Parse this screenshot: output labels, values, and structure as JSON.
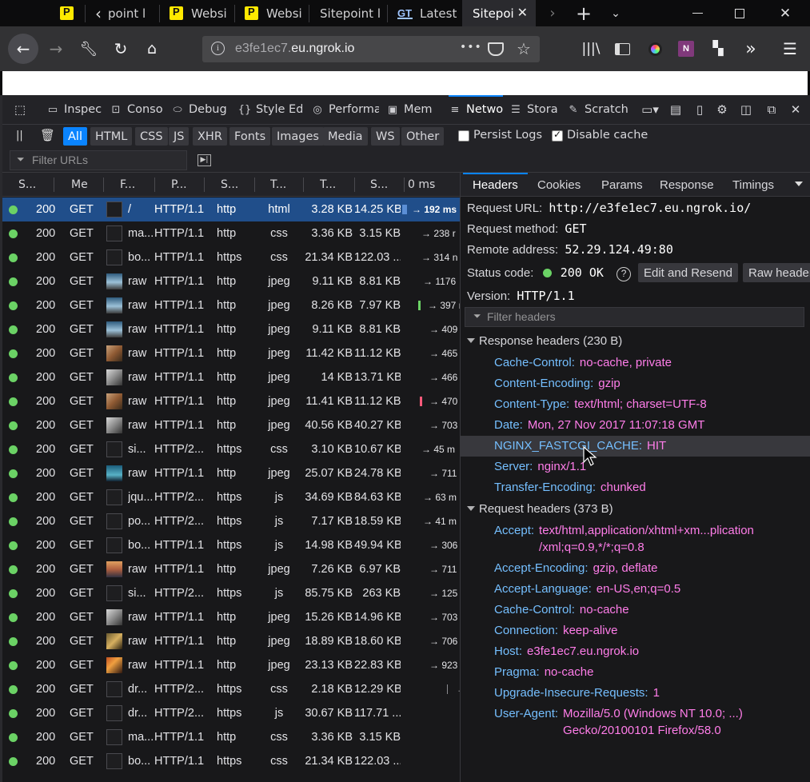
{
  "browser": {
    "tabs": [
      {
        "label": "",
        "icon": "sitepoint-icon"
      },
      {
        "label": "point l",
        "icon": "chevron-left-icon"
      },
      {
        "label": "Websi",
        "icon": "sitepoint-icon"
      },
      {
        "label": "Websi",
        "icon": "sitepoint-icon"
      },
      {
        "label": "Sitepoint l",
        "icon": ""
      },
      {
        "label": "Latest",
        "icon": "gt-icon"
      },
      {
        "label": "Sitepoi",
        "icon": ""
      }
    ],
    "url_prefix": "e3fe1ec7.",
    "url_domain": "eu.ngrok.io",
    "more_glyph": "•••"
  },
  "devtools": {
    "tabs": [
      "Inspec",
      "Conso",
      "Debug",
      "Style Ed",
      "Performa",
      "Mem",
      "Netwo",
      "Stora",
      "Scratch"
    ],
    "filters": [
      "All",
      "HTML",
      "CSS",
      "JS",
      "XHR",
      "Fonts",
      "Images",
      "Media",
      "WS",
      "Other"
    ],
    "persist_logs": "Persist Logs",
    "disable_cache": "Disable cache",
    "filter_urls_placeholder": "Filter URLs"
  },
  "table": {
    "headers": [
      "S...",
      "Me",
      "F...",
      "P...",
      "S...",
      "T...",
      "T...",
      "S...",
      "0 ms"
    ],
    "rows": [
      {
        "status": "200",
        "method": "GET",
        "file": "/",
        "proto": "HTTP/1.1",
        "scheme": "http",
        "type": "html",
        "transferred": "3.28 KB",
        "size": "14.25 KB",
        "timing": "→ 192 ms"
      },
      {
        "status": "200",
        "method": "GET",
        "file": "ma...",
        "proto": "HTTP/1.1",
        "scheme": "http",
        "type": "css",
        "transferred": "3.36 KB",
        "size": "3.15 KB",
        "timing": "→ 238 r"
      },
      {
        "status": "200",
        "method": "GET",
        "file": "bo...",
        "proto": "HTTP/1.1",
        "scheme": "https",
        "type": "css",
        "transferred": "21.34 KB",
        "size": "122.03 ...",
        "timing": "→ 314 n"
      },
      {
        "status": "200",
        "method": "GET",
        "file": "raw",
        "proto": "HTTP/1.1",
        "scheme": "http",
        "type": "jpeg",
        "transferred": "9.11 KB",
        "size": "8.81 KB",
        "timing": "→ 1176"
      },
      {
        "status": "200",
        "method": "GET",
        "file": "raw",
        "proto": "HTTP/1.1",
        "scheme": "http",
        "type": "jpeg",
        "transferred": "8.26 KB",
        "size": "7.97 KB",
        "timing": "→ 397 r"
      },
      {
        "status": "200",
        "method": "GET",
        "file": "raw",
        "proto": "HTTP/1.1",
        "scheme": "http",
        "type": "jpeg",
        "transferred": "9.11 KB",
        "size": "8.81 KB",
        "timing": "→ 409 r"
      },
      {
        "status": "200",
        "method": "GET",
        "file": "raw",
        "proto": "HTTP/1.1",
        "scheme": "http",
        "type": "jpeg",
        "transferred": "11.42 KB",
        "size": "11.12 KB",
        "timing": "→ 465 r"
      },
      {
        "status": "200",
        "method": "GET",
        "file": "raw",
        "proto": "HTTP/1.1",
        "scheme": "http",
        "type": "jpeg",
        "transferred": "14 KB",
        "size": "13.71 KB",
        "timing": "→ 466 r"
      },
      {
        "status": "200",
        "method": "GET",
        "file": "raw",
        "proto": "HTTP/1.1",
        "scheme": "http",
        "type": "jpeg",
        "transferred": "11.41 KB",
        "size": "11.12 KB",
        "timing": "→ 470 r"
      },
      {
        "status": "200",
        "method": "GET",
        "file": "raw",
        "proto": "HTTP/1.1",
        "scheme": "http",
        "type": "jpeg",
        "transferred": "40.56 KB",
        "size": "40.27 KB",
        "timing": "→ 703 r"
      },
      {
        "status": "200",
        "method": "GET",
        "file": "si...",
        "proto": "HTTP/2...",
        "scheme": "https",
        "type": "css",
        "transferred": "3.10 KB",
        "size": "10.67 KB",
        "timing": "→ 45 m"
      },
      {
        "status": "200",
        "method": "GET",
        "file": "raw",
        "proto": "HTTP/1.1",
        "scheme": "http",
        "type": "jpeg",
        "transferred": "25.07 KB",
        "size": "24.78 KB",
        "timing": "→ 711 r"
      },
      {
        "status": "200",
        "method": "GET",
        "file": "jqu...",
        "proto": "HTTP/2...",
        "scheme": "https",
        "type": "js",
        "transferred": "34.69 KB",
        "size": "84.63 KB",
        "timing": "→ 63 m"
      },
      {
        "status": "200",
        "method": "GET",
        "file": "po...",
        "proto": "HTTP/2...",
        "scheme": "https",
        "type": "js",
        "transferred": "7.17 KB",
        "size": "18.59 KB",
        "timing": "→ 41 m"
      },
      {
        "status": "200",
        "method": "GET",
        "file": "bo...",
        "proto": "HTTP/1.1",
        "scheme": "https",
        "type": "js",
        "transferred": "14.98 KB",
        "size": "49.94 KB",
        "timing": "→ 306 r"
      },
      {
        "status": "200",
        "method": "GET",
        "file": "raw",
        "proto": "HTTP/1.1",
        "scheme": "http",
        "type": "jpeg",
        "transferred": "7.26 KB",
        "size": "6.97 KB",
        "timing": "→ 711 r"
      },
      {
        "status": "200",
        "method": "GET",
        "file": "si...",
        "proto": "HTTP/2...",
        "scheme": "https",
        "type": "js",
        "transferred": "85.75 KB",
        "size": "263 KB",
        "timing": "→ 125 r"
      },
      {
        "status": "200",
        "method": "GET",
        "file": "raw",
        "proto": "HTTP/1.1",
        "scheme": "http",
        "type": "jpeg",
        "transferred": "15.26 KB",
        "size": "14.96 KB",
        "timing": "→ 703 r"
      },
      {
        "status": "200",
        "method": "GET",
        "file": "raw",
        "proto": "HTTP/1.1",
        "scheme": "http",
        "type": "jpeg",
        "transferred": "18.89 KB",
        "size": "18.60 KB",
        "timing": "→ 706 r"
      },
      {
        "status": "200",
        "method": "GET",
        "file": "raw",
        "proto": "HTTP/1.1",
        "scheme": "http",
        "type": "jpeg",
        "transferred": "23.13 KB",
        "size": "22.83 KB",
        "timing": "→ 923 r"
      },
      {
        "status": "200",
        "method": "GET",
        "file": "dr...",
        "proto": "HTTP/2...",
        "scheme": "https",
        "type": "css",
        "transferred": "2.18 KB",
        "size": "12.29 KB",
        "timing": "→"
      },
      {
        "status": "200",
        "method": "GET",
        "file": "dr...",
        "proto": "HTTP/2...",
        "scheme": "https",
        "type": "js",
        "transferred": "30.67 KB",
        "size": "117.71 ...",
        "timing": ""
      },
      {
        "status": "200",
        "method": "GET",
        "file": "ma...",
        "proto": "HTTP/1.1",
        "scheme": "http",
        "type": "css",
        "transferred": "3.36 KB",
        "size": "3.15 KB",
        "timing": ""
      },
      {
        "status": "200",
        "method": "GET",
        "file": "bo...",
        "proto": "HTTP/1.1",
        "scheme": "https",
        "type": "css",
        "transferred": "21.34 KB",
        "size": "122.03 ...",
        "timing": ""
      }
    ]
  },
  "panel": {
    "tabs": [
      "Headers",
      "Cookies",
      "Params",
      "Response",
      "Timings"
    ],
    "request_url_label": "Request URL:",
    "request_url": "http://e3fe1ec7.eu.ngrok.io/",
    "request_method_label": "Request method:",
    "request_method": "GET",
    "remote_address_label": "Remote address:",
    "remote_address": "52.29.124.49:80",
    "status_code_label": "Status code:",
    "status_code": "200 OK",
    "edit_resend": "Edit and Resend",
    "raw_headers": "Raw header",
    "version_label": "Version:",
    "version": "HTTP/1.1",
    "filter_headers_placeholder": "Filter headers",
    "response_section": "Response headers (230 B)",
    "response_headers": [
      {
        "name": "Cache-Control:",
        "value": "no-cache, private"
      },
      {
        "name": "Content-Encoding:",
        "value": "gzip"
      },
      {
        "name": "Content-Type:",
        "value": "text/html; charset=UTF-8"
      },
      {
        "name": "Date:",
        "value": "Mon, 27 Nov 2017 11:07:18 GMT"
      },
      {
        "name": "NGINX_FASTCGI_CACHE:",
        "value": "HIT"
      },
      {
        "name": "Server:",
        "value": "nginx/1.1"
      },
      {
        "name": "Transfer-Encoding:",
        "value": "chunked"
      }
    ],
    "request_section": "Request headers (373 B)",
    "request_headers": [
      {
        "name": "Accept:",
        "value": "text/html,application/xhtml+xm...plication",
        "value2": "/xml;q=0.9,*/*;q=0.8"
      },
      {
        "name": "Accept-Encoding:",
        "value": "gzip, deflate"
      },
      {
        "name": "Accept-Language:",
        "value": "en-US,en;q=0.5"
      },
      {
        "name": "Cache-Control:",
        "value": "no-cache"
      },
      {
        "name": "Connection:",
        "value": "keep-alive"
      },
      {
        "name": "Host:",
        "value": "e3fe1ec7.eu.ngrok.io"
      },
      {
        "name": "Pragma:",
        "value": "no-cache"
      },
      {
        "name": "Upgrade-Insecure-Requests:",
        "value": "1"
      },
      {
        "name": "User-Agent:",
        "value": "Mozilla/5.0 (Windows NT 10.0; ...)",
        "value2": "Gecko/20100101 Firefox/58.0"
      }
    ]
  },
  "colors": {
    "accent": "#0a84ff",
    "status_ok": "#6bd265",
    "header_name": "#75bfff",
    "header_value": "#ff7de9",
    "selected_row": "#204e8a"
  }
}
